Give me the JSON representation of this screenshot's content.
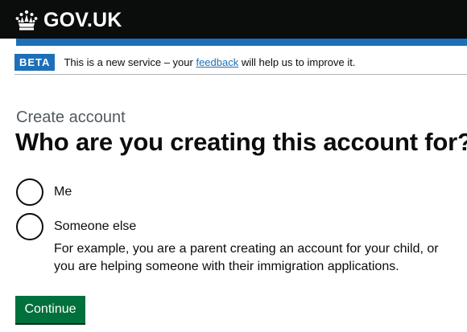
{
  "header": {
    "logo_text": "GOV.UK",
    "logo_icon": "crown-icon"
  },
  "phase_banner": {
    "tag": "BETA",
    "text_before": "This is a new service – your ",
    "link_text": "feedback",
    "text_after": " will help us to improve it."
  },
  "page": {
    "caption": "Create account",
    "heading": "Who are you creating this account for?"
  },
  "radios": [
    {
      "label": "Me",
      "selected": false
    },
    {
      "label": "Someone else",
      "selected": false,
      "hint": "For example, you are a parent creating an account for your child, or you are helping someone with their immigration applications."
    }
  ],
  "actions": {
    "continue_label": "Continue"
  },
  "colors": {
    "header_bg": "#0b0c0c",
    "brand_blue": "#1d70b8",
    "button_green": "#00703c",
    "text": "#0b0c0c",
    "secondary_text": "#505a5f"
  }
}
